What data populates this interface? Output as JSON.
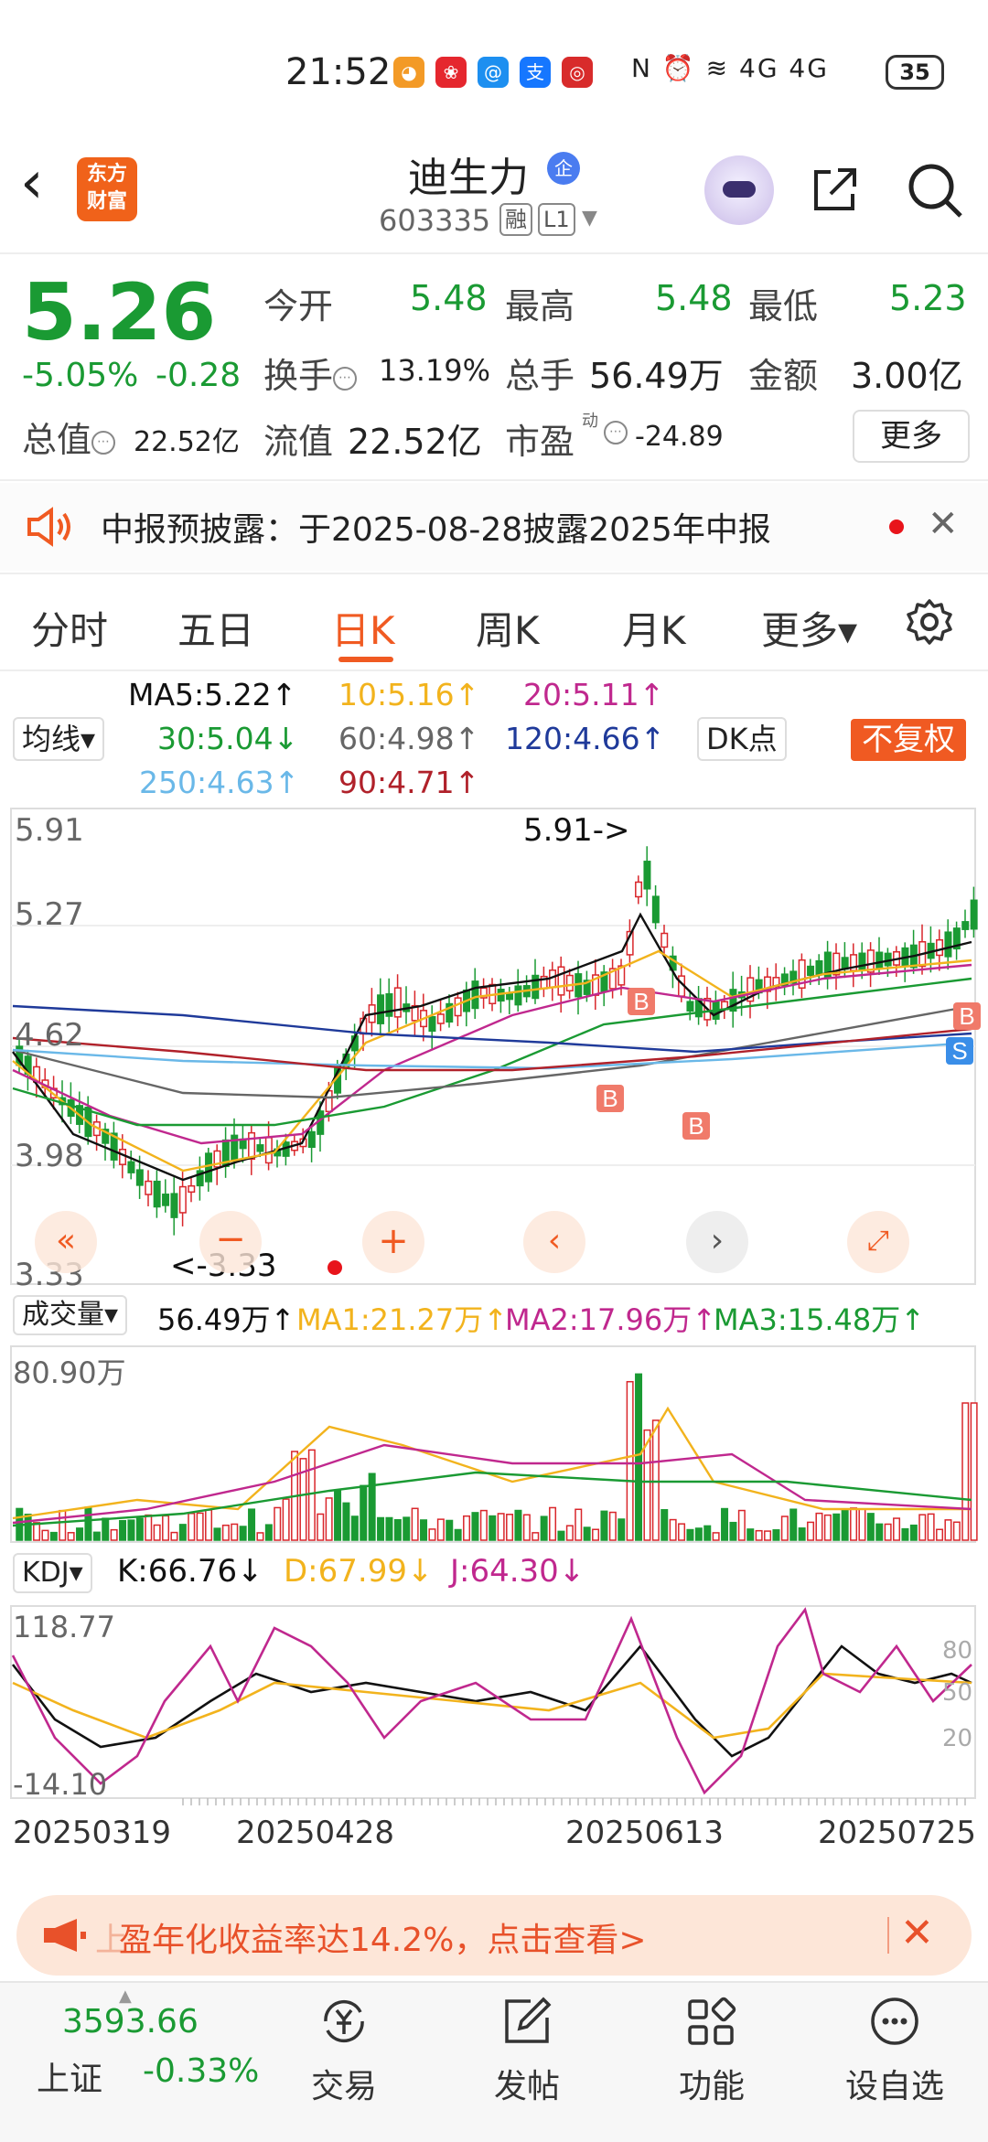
{
  "status_bar": {
    "time": "21:52",
    "signal": "4G 4G",
    "battery": "35"
  },
  "header": {
    "name": "迪生力",
    "badge": "企",
    "code": "603335",
    "tags": [
      "融",
      "L1"
    ],
    "logo": [
      "东方",
      "财富"
    ]
  },
  "quote": {
    "price": "5.26",
    "change_pct": "-5.05%",
    "change_abs": "-0.28",
    "open_label": "今开",
    "open": "5.48",
    "high_label": "最高",
    "high": "5.48",
    "low_label": "最低",
    "low": "5.23",
    "turnover_label": "换手",
    "turnover": "13.19%",
    "volume_label": "总手",
    "volume": "56.49万",
    "amount_label": "金额",
    "amount": "3.00亿",
    "mktcap_label": "总值",
    "mktcap": "22.52亿",
    "float_label": "流值",
    "float_cap": "22.52亿",
    "pe_label": "市盈",
    "pe_sup": "动",
    "pe": "-24.89",
    "more": "更多"
  },
  "notice": {
    "text": "中报预披露：于2025-08-28披露2025年中报"
  },
  "tabs": [
    "分时",
    "五日",
    "日K",
    "周K",
    "月K",
    "更多▾"
  ],
  "active_tab": "日K",
  "ma_legend": {
    "selector": "均线▾",
    "ma5": "MA5:5.22↑",
    "ma10": "10:5.16↑",
    "ma20": "20:5.11↑",
    "ma30": "30:5.04↓",
    "ma60": "60:4.98↑",
    "ma120": "120:4.66↑",
    "ma250": "250:4.63↑",
    "ma90": "90:4.71↑",
    "dk": "DK点",
    "adjust": "不复权",
    "colors": {
      "ma5": "#111111",
      "ma10": "#f2b31d",
      "ma20": "#c0288e",
      "ma30": "#1a9a33",
      "ma60": "#666666",
      "ma120": "#1f3a9a",
      "ma250": "#6ab8e8",
      "ma90": "#b0212a"
    }
  },
  "kline": {
    "y_labels": [
      "5.91",
      "5.27",
      "4.62",
      "3.98",
      "3.33"
    ],
    "max_callout": "5.91->",
    "min_callout": "<-3.33",
    "signals": [
      "B",
      "B",
      "B",
      "B",
      "S"
    ]
  },
  "volume": {
    "selector": "成交量▾",
    "value": "56.49万↑",
    "ma1": "MA1:21.27万↑",
    "ma2": "MA2:17.96万↑",
    "ma3": "MA3:15.48万↑",
    "max_label": "80.90万"
  },
  "kdj": {
    "selector": "KDJ▾",
    "k": "K:66.76↓",
    "d": "D:67.99↓",
    "j": "J:64.30↓",
    "max_label": "118.77",
    "min_label": "-14.10",
    "levels": [
      "80",
      "50",
      "20"
    ]
  },
  "dates": [
    "20250319",
    "20250428",
    "20250613",
    "20250725"
  ],
  "banner": {
    "text": "盈年化收益率达14.2%，点击查看>"
  },
  "index": {
    "value": "3593.66",
    "name": "上证",
    "change": "-0.33%"
  },
  "nav": [
    {
      "label": "交易",
      "icon": "yuan-refresh-icon"
    },
    {
      "label": "发帖",
      "icon": "edit-icon"
    },
    {
      "label": "功能",
      "icon": "grid-icon"
    },
    {
      "label": "设自选",
      "icon": "more-circle-icon"
    }
  ]
}
